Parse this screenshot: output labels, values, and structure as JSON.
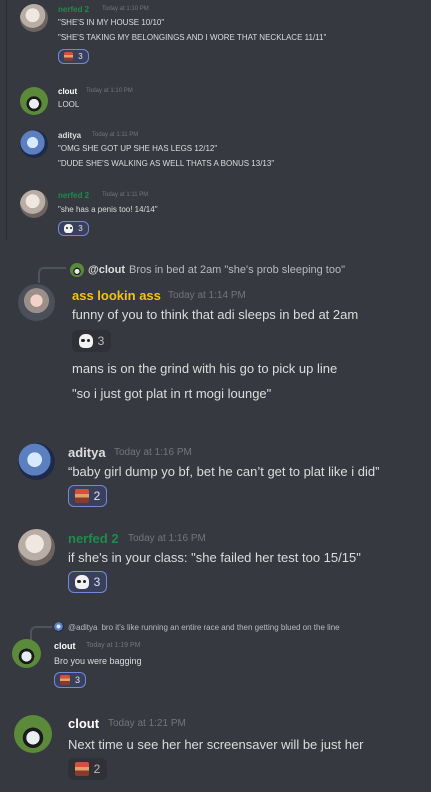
{
  "colors": {
    "bg": "#36393f",
    "nerfed": "#1f8b4c",
    "clout": "#ffffff",
    "aditya": "#dcddde",
    "ass": "#f1c40f"
  },
  "m1": {
    "name": "nerfed 2",
    "time": "Today at 1:10 PM",
    "lines": [
      "\"SHE'S IN MY HOUSE 10/10\"",
      "\"SHE'S TAKING MY BELONGINGS AND I WORE THAT NECKLACE 11/11\""
    ],
    "react_count": "3"
  },
  "m2": {
    "name": "clout",
    "time": "Today at 1:10 PM",
    "lines": [
      "LOOL"
    ]
  },
  "m3": {
    "name": "aditya",
    "time": "Today at 1:11 PM",
    "lines": [
      "\"OMG SHE GOT UP SHE HAS LEGS 12/12\"",
      "\"DUDE SHE'S WALKING AS WELL THATS A BONUS 13/13\""
    ]
  },
  "m4": {
    "name": "nerfed 2",
    "time": "Today at 1:11 PM",
    "lines": [
      "\"she has a penis too! 14/14\""
    ],
    "react_count": "3"
  },
  "m5": {
    "reply_name": "@clout",
    "reply_text": "Bros in bed at 2am \"she's prob sleeping too\"",
    "name": "ass lookin ass",
    "time": "Today at 1:14 PM",
    "lines": [
      "funny of you to think that adi sleeps in bed at 2am",
      "mans is on the grind with his go to pick up line",
      "\"so i just got plat in rt mogi lounge\""
    ],
    "react_count": "3"
  },
  "m6": {
    "name": "aditya",
    "time": "Today at 1:16 PM",
    "lines": [
      "“baby girl dump yo bf, bet he can’t get to plat like i did”"
    ],
    "react_count": "2"
  },
  "m7": {
    "name": "nerfed 2",
    "time": "Today at 1:16 PM",
    "lines": [
      "if she's in your class: \"she failed her test too 15/15\""
    ],
    "react_count": "3"
  },
  "m8": {
    "reply_name": "@aditya",
    "reply_text": "bro it's like running an entire race and then getting blued on the line",
    "name": "clout",
    "time": "Today at 1:19 PM",
    "lines": [
      "Bro you were bagging"
    ],
    "react_count": "3"
  },
  "m9": {
    "name": "clout",
    "time": "Today at 1:21 PM",
    "lines": [
      "Next time u see her her screensaver will be just her"
    ],
    "react_count": "2"
  }
}
